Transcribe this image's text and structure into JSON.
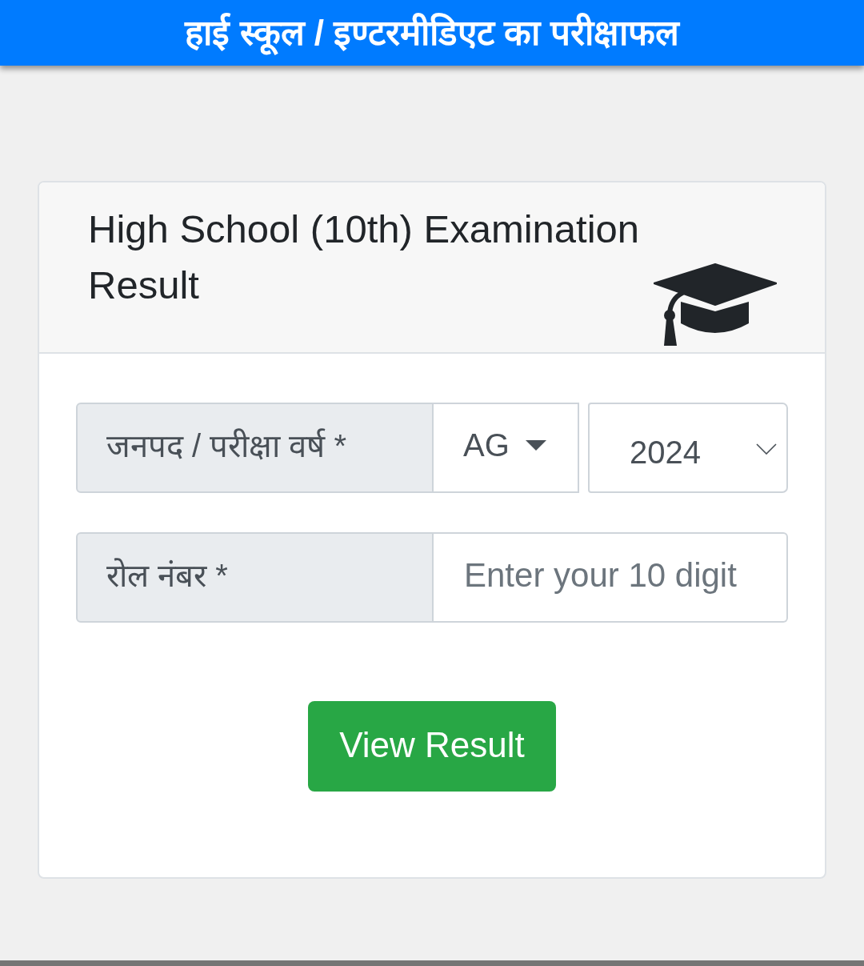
{
  "header": {
    "title": "हाई स्कूल / इण्टरमीडिएट का परीक्षाफल"
  },
  "card": {
    "title": "High School (10th) Examination Result",
    "fields": [
      {
        "kind": "selects",
        "label": "जनपद / परीक्षा वर्ष *",
        "selects": [
          {
            "kind": "caret",
            "value": "AG"
          },
          {
            "kind": "chevron",
            "value": "2024"
          }
        ]
      },
      {
        "kind": "input",
        "label": "रोल नंबर *",
        "placeholder": "Enter your 10 digit"
      }
    ],
    "button": {
      "label": "View Result"
    }
  }
}
